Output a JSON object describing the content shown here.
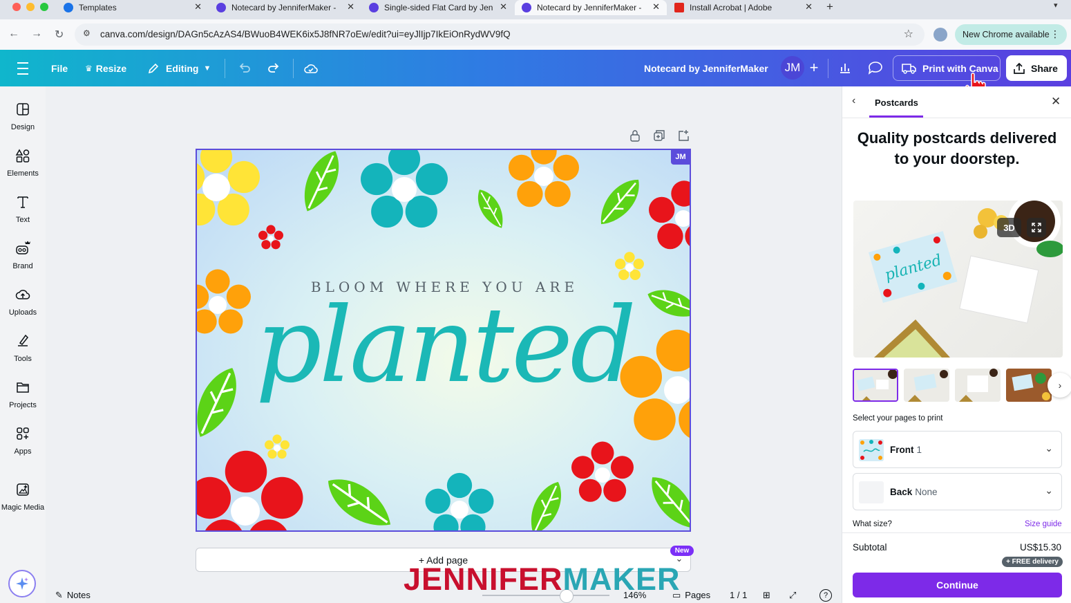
{
  "browser": {
    "tabs": [
      {
        "title": "Templates",
        "favicon_color": "#1a73e8"
      },
      {
        "title": "Notecard by JenniferMaker -",
        "favicon_color": "#5a3fe0"
      },
      {
        "title": "Single-sided Flat Card by Jen",
        "favicon_color": "#5a3fe0"
      },
      {
        "title": "Notecard by JenniferMaker -",
        "favicon_color": "#5a3fe0"
      },
      {
        "title": "Install Acrobat | Adobe",
        "favicon_color": "#e1251b"
      }
    ],
    "new_tab": "+",
    "close_glyph": "✕",
    "url": "canva.com/design/DAGn5cAzAS4/BWuoB4WEK6ix5J8fNR7oEw/edit?ui=eyJlIjp7IkEiOnRydWV9fQ",
    "update_label": "New Chrome available"
  },
  "header": {
    "file": "File",
    "resize": "Resize",
    "editing": "Editing",
    "doc_title": "Notecard by JenniferMaker",
    "avatar_initials": "JM",
    "print": "Print with Canva",
    "share": "Share",
    "accent": "#5a3fe0"
  },
  "sidebar": {
    "items": [
      {
        "label": "Design",
        "icon": "design-icon"
      },
      {
        "label": "Elements",
        "icon": "elements-icon"
      },
      {
        "label": "Text",
        "icon": "text-icon"
      },
      {
        "label": "Brand",
        "icon": "brand-icon"
      },
      {
        "label": "Uploads",
        "icon": "upload-cloud-icon"
      },
      {
        "label": "Tools",
        "icon": "tools-icon"
      },
      {
        "label": "Projects",
        "icon": "folder-icon"
      },
      {
        "label": "Apps",
        "icon": "apps-icon"
      },
      {
        "label": "Magic Media",
        "icon": "magic-media-icon"
      }
    ]
  },
  "canvas": {
    "owner_badge": "JM",
    "tagline": "BLOOM WHERE YOU ARE",
    "main_word": "planted",
    "add_page": "+ Add page",
    "new_badge": "New"
  },
  "bottom_bar": {
    "notes": "Notes",
    "zoom_level": "146%",
    "pages_label": "Pages",
    "page_count": "1 / 1",
    "help": "?"
  },
  "watermark": {
    "part1": "JENNIFER",
    "part2": "MAKER"
  },
  "panel": {
    "tab": "Postcards",
    "headline": "Quality postcards delivered to your doorstep.",
    "btn_3d": "3D",
    "select_pages_label": "Select your pages to print",
    "front_label": "Front",
    "front_value": "1",
    "back_label": "Back",
    "back_value": "None",
    "size_question": "What size?",
    "size_guide": "Size guide",
    "subtotal_label": "Subtotal",
    "subtotal_value": "US$15.30",
    "free_delivery": "+ FREE delivery",
    "continue": "Continue",
    "mockup_card_text": "planted"
  }
}
